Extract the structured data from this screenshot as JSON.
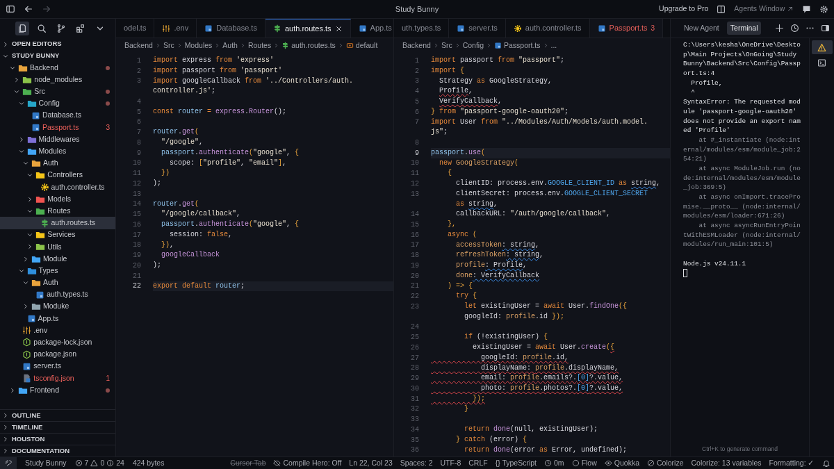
{
  "title_bar": {
    "title": "Study Bunny",
    "navigation": [
      {
        "kind": "back",
        "disabled": false
      },
      {
        "kind": "forward",
        "disabled": true
      }
    ],
    "actions": [
      {
        "kind": "upgrade",
        "label": "Upgrade to Pro"
      },
      {
        "kind": "agents",
        "label": "Agents Window"
      }
    ]
  },
  "activity": [
    {
      "kind": "explorer",
      "selected": true
    },
    {
      "kind": "search",
      "selected": false
    },
    {
      "kind": "scm",
      "selected": false
    },
    {
      "kind": "extensions",
      "selected": false
    },
    {
      "kind": "more",
      "selected": false
    }
  ],
  "explorer": {
    "sections": [
      {
        "title": "OPEN EDITORS",
        "expanded": false
      },
      {
        "title": "STUDY BUNNY",
        "expanded": true
      }
    ],
    "tree": [
      {
        "name": "Backend",
        "kind": "folder",
        "color": "#e8a33d",
        "expanded": true,
        "modified": true,
        "selected": false,
        "children": [
          {
            "name": "node_modules",
            "kind": "folder",
            "color": "#8bc34a",
            "expanded": false,
            "selected": false
          },
          {
            "name": "Src",
            "kind": "folder",
            "color": "#4caf50",
            "expanded": true,
            "modified": true,
            "selected": false,
            "children": [
              {
                "name": "Config",
                "kind": "folder",
                "color": "#26a6c9",
                "expanded": true,
                "modified": true,
                "selected": false,
                "children": [
                  {
                    "name": "Database.ts",
                    "kind": "ts",
                    "selected": false
                  },
                  {
                    "name": "Passport.ts",
                    "kind": "ts",
                    "error": true,
                    "badge": "3",
                    "selected": false
                  }
                ]
              },
              {
                "name": "Middlewares",
                "kind": "folder",
                "color": "#7e6fd6",
                "expanded": false,
                "selected": false
              },
              {
                "name": "Modules",
                "kind": "folder",
                "color": "#42a5f5",
                "expanded": true,
                "selected": false,
                "children": [
                  {
                    "name": "Auth",
                    "kind": "folder",
                    "color": "#e8a33d",
                    "expanded": true,
                    "selected": false,
                    "children": [
                      {
                        "name": "Controllers",
                        "kind": "folder",
                        "color": "#f5c518",
                        "expanded": true,
                        "selected": false,
                        "children": [
                          {
                            "name": "auth.controller.ts",
                            "kind": "gear",
                            "selected": false
                          }
                        ]
                      },
                      {
                        "name": "Models",
                        "kind": "folder",
                        "color": "#ef5350",
                        "expanded": false,
                        "selected": false
                      },
                      {
                        "name": "Routes",
                        "kind": "folder",
                        "color": "#4caf50",
                        "expanded": true,
                        "selected": false,
                        "children": [
                          {
                            "name": "auth.routes.ts",
                            "kind": "route",
                            "selected": true
                          }
                        ]
                      },
                      {
                        "name": "Services",
                        "kind": "folder",
                        "color": "#f5c518",
                        "expanded": true,
                        "selected": false
                      },
                      {
                        "name": "Utils",
                        "kind": "folder",
                        "color": "#8bc34a",
                        "expanded": false,
                        "selected": false
                      }
                    ]
                  },
                  {
                    "name": "Module",
                    "kind": "folder",
                    "color": "#42a5f5",
                    "expanded": false,
                    "selected": false
                  }
                ]
              },
              {
                "name": "Types",
                "kind": "folder",
                "color": "#2f8fdc",
                "expanded": true,
                "selected": false,
                "children": [
                  {
                    "name": "Auth",
                    "kind": "folder",
                    "color": "#e8a33d",
                    "expanded": true,
                    "selected": false,
                    "children": [
                      {
                        "name": "auth.types.ts",
                        "kind": "ts",
                        "selected": false
                      }
                    ]
                  },
                  {
                    "name": "Moduke",
                    "kind": "folder",
                    "color": "#90a4ae",
                    "expanded": false,
                    "selected": false
                  }
                ]
              },
              {
                "name": "App.ts",
                "kind": "ts",
                "selected": false
              }
            ]
          },
          {
            "name": ".env",
            "kind": "env",
            "selected": false
          },
          {
            "name": "package-lock.json",
            "kind": "json",
            "selected": false
          },
          {
            "name": "package.json",
            "kind": "json",
            "selected": false
          },
          {
            "name": "server.ts",
            "kind": "ts",
            "selected": false
          },
          {
            "name": "tsconfig.json",
            "kind": "tsconfig",
            "error": true,
            "badge": "1",
            "selected": false
          }
        ]
      },
      {
        "name": "Frontend",
        "kind": "folder",
        "color": "#42a5f5",
        "expanded": false,
        "modified": true,
        "selected": false
      }
    ],
    "panels": [
      {
        "title": "OUTLINE",
        "expanded": false
      },
      {
        "title": "TIMELINE",
        "expanded": false
      },
      {
        "title": "HOUSTON",
        "expanded": false
      },
      {
        "title": "DOCUMENTATION",
        "expanded": false
      }
    ]
  },
  "editors": [
    {
      "focused": true,
      "tabs": [
        {
          "label": "odel.ts",
          "selected": false
        },
        {
          "label": ".env",
          "kind": "env",
          "selected": false
        },
        {
          "label": "Database.ts",
          "kind": "ts",
          "selected": false
        },
        {
          "label": "auth.routes.ts",
          "kind": "route",
          "selected": true
        },
        {
          "label": "App.ts",
          "kind": "ts",
          "selected": false
        }
      ],
      "breadcrumbs": [
        {
          "label": "Backend",
          "kind": "folder"
        },
        {
          "label": "Src",
          "kind": "folder"
        },
        {
          "label": "Modules",
          "kind": "folder"
        },
        {
          "label": "Auth",
          "kind": "folder"
        },
        {
          "label": "Routes",
          "kind": "folder"
        },
        {
          "label": "auth.routes.ts",
          "kind": "route"
        },
        {
          "label": "default",
          "kind": "symbol"
        }
      ],
      "lines": [
        {
          "n": "1",
          "seg": [
            {
              "text": "import ",
              "kind": "keyword"
            },
            {
              "text": "express ",
              "kind": "plain"
            },
            {
              "text": "from ",
              "kind": "keyword"
            },
            {
              "text": "'express'",
              "kind": "string"
            }
          ]
        },
        {
          "n": "2",
          "seg": [
            {
              "text": "import ",
              "kind": "keyword"
            },
            {
              "text": "passport ",
              "kind": "plain"
            },
            {
              "text": "from ",
              "kind": "keyword"
            },
            {
              "text": "'passport'",
              "kind": "string"
            }
          ]
        },
        {
          "n": "3",
          "seg": [
            {
              "text": "import ",
              "kind": "keyword"
            },
            {
              "text": "googleCallback ",
              "kind": "plain"
            },
            {
              "text": "from ",
              "kind": "keyword"
            },
            {
              "text": "'../Controllers/auth.",
              "kind": "string"
            }
          ]
        },
        {
          "seg": [
            {
              "text": "controller.js'",
              "kind": "string"
            },
            {
              "text": ";",
              "kind": "plain"
            }
          ]
        },
        {
          "n": "4"
        },
        {
          "n": "5",
          "seg": [
            {
              "text": "const ",
              "kind": "keyword"
            },
            {
              "text": "router ",
              "kind": "variable"
            },
            {
              "text": "= ",
              "kind": "keyword"
            },
            {
              "text": "express",
              "kind": "function"
            },
            {
              "text": ".",
              "kind": "plain"
            },
            {
              "text": "Router",
              "kind": "function"
            },
            {
              "text": "();",
              "kind": "plain"
            }
          ]
        },
        {
          "n": "6"
        },
        {
          "n": "7",
          "seg": [
            {
              "text": "router",
              "kind": "variable"
            },
            {
              "text": ".",
              "kind": "plain"
            },
            {
              "text": "get",
              "kind": "function"
            },
            {
              "text": "(",
              "kind": "bracket"
            }
          ]
        },
        {
          "n": "8",
          "seg": [
            {
              "text": "  \"/google\"",
              "kind": "string"
            },
            {
              "text": ",",
              "kind": "plain"
            }
          ]
        },
        {
          "n": "9",
          "seg": [
            {
              "text": "  passport",
              "kind": "variable"
            },
            {
              "text": ".",
              "kind": "plain"
            },
            {
              "text": "authenticate",
              "kind": "function"
            },
            {
              "text": "(",
              "kind": "bracket"
            },
            {
              "text": "\"google\"",
              "kind": "string"
            },
            {
              "text": ", ",
              "kind": "plain"
            },
            {
              "text": "{",
              "kind": "bracket"
            }
          ]
        },
        {
          "n": "10",
          "seg": [
            {
              "text": "    scope: ",
              "kind": "plain"
            },
            {
              "text": "[",
              "kind": "bracket"
            },
            {
              "text": "\"profile\"",
              "kind": "string"
            },
            {
              "text": ", ",
              "kind": "plain"
            },
            {
              "text": "\"email\"",
              "kind": "string"
            },
            {
              "text": "]",
              "kind": "bracket"
            },
            {
              "text": ",",
              "kind": "plain"
            }
          ]
        },
        {
          "n": "11",
          "seg": [
            {
              "text": "  })",
              "kind": "bracket"
            }
          ]
        },
        {
          "n": "12",
          "seg": [
            {
              "text": ");",
              "kind": "plain"
            }
          ]
        },
        {
          "n": "13"
        },
        {
          "n": "14",
          "seg": [
            {
              "text": "router",
              "kind": "variable"
            },
            {
              "text": ".",
              "kind": "plain"
            },
            {
              "text": "get",
              "kind": "function"
            },
            {
              "text": "(",
              "kind": "bracket"
            }
          ]
        },
        {
          "n": "15",
          "seg": [
            {
              "text": "  \"/google/callback\"",
              "kind": "string"
            },
            {
              "text": ",",
              "kind": "plain"
            }
          ]
        },
        {
          "n": "16",
          "seg": [
            {
              "text": "  passport",
              "kind": "variable"
            },
            {
              "text": ".",
              "kind": "plain"
            },
            {
              "text": "authenticate",
              "kind": "function"
            },
            {
              "text": "(",
              "kind": "bracket"
            },
            {
              "text": "\"google\"",
              "kind": "string"
            },
            {
              "text": ", ",
              "kind": "plain"
            },
            {
              "text": "{",
              "kind": "bracket"
            }
          ]
        },
        {
          "n": "17",
          "seg": [
            {
              "text": "    session: ",
              "kind": "plain"
            },
            {
              "text": "false",
              "kind": "keyword"
            },
            {
              "text": ",",
              "kind": "plain"
            }
          ]
        },
        {
          "n": "18",
          "seg": [
            {
              "text": "  })",
              "kind": "bracket"
            },
            {
              "text": ",",
              "kind": "plain"
            }
          ]
        },
        {
          "n": "19",
          "seg": [
            {
              "text": "  googleCallback",
              "kind": "function"
            }
          ]
        },
        {
          "n": "20",
          "seg": [
            {
              "text": ");",
              "kind": "plain"
            }
          ]
        },
        {
          "n": "21"
        },
        {
          "n": "22",
          "current": true,
          "seg": [
            {
              "text": "export default ",
              "kind": "keyword"
            },
            {
              "text": "router",
              "kind": "variable"
            },
            {
              "text": ";",
              "kind": "plain"
            }
          ]
        }
      ]
    },
    {
      "focused": false,
      "tabs": [
        {
          "label": "uth.types.ts",
          "selected": false
        },
        {
          "label": "server.ts",
          "kind": "ts",
          "selected": false
        },
        {
          "label": "auth.controller.ts",
          "kind": "gear",
          "selected": false
        },
        {
          "label": "Passport.ts",
          "kind": "ts",
          "selected": true,
          "error": true,
          "badge": "3"
        }
      ],
      "breadcrumbs": [
        {
          "label": "Backend",
          "kind": "folder"
        },
        {
          "label": "Src",
          "kind": "folder"
        },
        {
          "label": "Config",
          "kind": "folder"
        },
        {
          "label": "Passport.ts",
          "kind": "ts"
        },
        {
          "label": "...",
          "kind": "more"
        }
      ],
      "lines": [
        {
          "n": "1",
          "seg": [
            {
              "text": "import ",
              "kind": "keyword"
            },
            {
              "text": "passport ",
              "kind": "plain"
            },
            {
              "text": "from ",
              "kind": "keyword"
            },
            {
              "text": "\"passport\"",
              "kind": "string"
            },
            {
              "text": ";",
              "kind": "plain"
            }
          ]
        },
        {
          "n": "2",
          "seg": [
            {
              "text": "import ",
              "kind": "keyword"
            },
            {
              "text": "{",
              "kind": "bracket"
            }
          ]
        },
        {
          "n": "3",
          "seg": [
            {
              "text": "  Strategy ",
              "kind": "plain"
            },
            {
              "text": "as ",
              "kind": "keyword"
            },
            {
              "text": "GoogleStrategy,",
              "kind": "plain"
            }
          ]
        },
        {
          "n": "4",
          "seg": [
            {
              "text": "  Profile",
              "kind": "plain",
              "error": true
            },
            {
              "text": ",",
              "kind": "plain"
            }
          ]
        },
        {
          "n": "5",
          "seg": [
            {
              "text": "  VerifyCallback",
              "kind": "plain",
              "error": true
            },
            {
              "text": ",",
              "kind": "plain"
            }
          ]
        },
        {
          "n": "6",
          "seg": [
            {
              "text": "} ",
              "kind": "bracket"
            },
            {
              "text": "from ",
              "kind": "keyword"
            },
            {
              "text": "\"passport-google-oauth20\"",
              "kind": "string"
            },
            {
              "text": ";",
              "kind": "plain"
            }
          ]
        },
        {
          "n": "7",
          "seg": [
            {
              "text": "import ",
              "kind": "keyword"
            },
            {
              "text": "User ",
              "kind": "plain"
            },
            {
              "text": "from ",
              "kind": "keyword"
            },
            {
              "text": "\"../Modules/Auth/Models/auth.model.",
              "kind": "string"
            }
          ]
        },
        {
          "seg": [
            {
              "text": "js\"",
              "kind": "string"
            },
            {
              "text": ";",
              "kind": "plain"
            }
          ]
        },
        {
          "n": "8"
        },
        {
          "n": "9",
          "current": true,
          "seg": [
            {
              "text": "passport",
              "kind": "variable"
            },
            {
              "text": ".",
              "kind": "plain"
            },
            {
              "text": "use",
              "kind": "function"
            },
            {
              "text": "(",
              "kind": "bracket"
            }
          ]
        },
        {
          "n": "10",
          "seg": [
            {
              "text": "  new ",
              "kind": "keyword"
            },
            {
              "text": "GoogleStrategy",
              "kind": "param"
            },
            {
              "text": "(",
              "kind": "bracket"
            }
          ]
        },
        {
          "n": "11",
          "seg": [
            {
              "text": "    {",
              "kind": "bracket"
            }
          ]
        },
        {
          "n": "12",
          "seg": [
            {
              "text": "      clientID: process.env.",
              "kind": "plain"
            },
            {
              "text": "GOOGLE_CLIENT_ID ",
              "kind": "constant"
            },
            {
              "text": "as ",
              "kind": "keyword"
            },
            {
              "text": "string",
              "kind": "plain",
              "warning": true
            },
            {
              "text": ",",
              "kind": "plain"
            }
          ]
        },
        {
          "n": "13",
          "seg": [
            {
              "text": "      clientSecret: process.env.",
              "kind": "plain"
            },
            {
              "text": "GOOGLE_CLIENT_SECRET",
              "kind": "constant"
            }
          ]
        },
        {
          "seg": [
            {
              "text": "      as ",
              "kind": "keyword"
            },
            {
              "text": "string",
              "kind": "plain",
              "warning": true
            },
            {
              "text": ",",
              "kind": "plain"
            }
          ]
        },
        {
          "n": "14",
          "seg": [
            {
              "text": "      callbackURL: ",
              "kind": "plain"
            },
            {
              "text": "\"/auth/google/callback\"",
              "kind": "string"
            },
            {
              "text": ",",
              "kind": "plain"
            }
          ]
        },
        {
          "n": "15",
          "seg": [
            {
              "text": "    },",
              "kind": "bracket"
            }
          ]
        },
        {
          "n": "16",
          "seg": [
            {
              "text": "    async ",
              "kind": "keyword"
            },
            {
              "text": "(",
              "kind": "bracket"
            }
          ]
        },
        {
          "n": "17",
          "seg": [
            {
              "text": "      accessToken",
              "kind": "param"
            },
            {
              "text": ": string",
              "kind": "plain",
              "warning": true
            },
            {
              "text": ",",
              "kind": "plain"
            }
          ]
        },
        {
          "n": "18",
          "seg": [
            {
              "text": "      refreshToken",
              "kind": "param"
            },
            {
              "text": ": string",
              "kind": "plain",
              "warning": true
            },
            {
              "text": ",",
              "kind": "plain"
            }
          ]
        },
        {
          "n": "19",
          "seg": [
            {
              "text": "      profile",
              "kind": "param"
            },
            {
              "text": ": Profile",
              "kind": "plain",
              "warning": true
            },
            {
              "text": ",",
              "kind": "plain"
            }
          ]
        },
        {
          "n": "20",
          "seg": [
            {
              "text": "      done",
              "kind": "param"
            },
            {
              "text": ": VerifyCallback",
              "kind": "plain",
              "warning": true
            }
          ]
        },
        {
          "n": "21",
          "seg": [
            {
              "text": "    ) => {",
              "kind": "bracket"
            }
          ]
        },
        {
          "n": "22",
          "seg": [
            {
              "text": "      try ",
              "kind": "keyword"
            },
            {
              "text": "{",
              "kind": "bracket"
            }
          ]
        },
        {
          "n": "23",
          "seg": [
            {
              "text": "        let ",
              "kind": "keyword"
            },
            {
              "text": "existingUser = ",
              "kind": "plain"
            },
            {
              "text": "await ",
              "kind": "keyword"
            },
            {
              "text": "User.",
              "kind": "plain"
            },
            {
              "text": "findOne",
              "kind": "function"
            },
            {
              "text": "({",
              "kind": "bracket"
            }
          ]
        },
        {
          "seg": [
            {
              "text": "        googleId: ",
              "kind": "plain"
            },
            {
              "text": "profile",
              "kind": "param"
            },
            {
              "text": ".id ",
              "kind": "plain"
            },
            {
              "text": "});",
              "kind": "bracket"
            }
          ]
        },
        {
          "n": "24"
        },
        {
          "n": "25",
          "seg": [
            {
              "text": "        if ",
              "kind": "keyword"
            },
            {
              "text": "(!existingUser) ",
              "kind": "plain"
            },
            {
              "text": "{",
              "kind": "bracket"
            }
          ]
        },
        {
          "n": "26",
          "seg": [
            {
              "text": "          existingUser = ",
              "kind": "plain"
            },
            {
              "text": "await ",
              "kind": "keyword"
            },
            {
              "text": "User.",
              "kind": "plain"
            },
            {
              "text": "create",
              "kind": "function"
            },
            {
              "text": "(",
              "kind": "bracket"
            },
            {
              "text": "{",
              "kind": "bracket",
              "error": true
            }
          ]
        },
        {
          "n": "27",
          "error": true,
          "seg": [
            {
              "text": "            googleId: ",
              "kind": "plain"
            },
            {
              "text": "profile",
              "kind": "param"
            },
            {
              "text": ".id,",
              "kind": "plain"
            }
          ]
        },
        {
          "n": "28",
          "error": true,
          "seg": [
            {
              "text": "            displayName: ",
              "kind": "plain"
            },
            {
              "text": "profile",
              "kind": "param"
            },
            {
              "text": ".displayName,",
              "kind": "plain"
            }
          ]
        },
        {
          "n": "29",
          "error": true,
          "seg": [
            {
              "text": "            email: ",
              "kind": "plain"
            },
            {
              "text": "profile",
              "kind": "param"
            },
            {
              "text": ".emails?.",
              "kind": "plain"
            },
            {
              "text": "[0]",
              "kind": "constant"
            },
            {
              "text": "?.value,",
              "kind": "plain"
            }
          ]
        },
        {
          "n": "30",
          "error": true,
          "seg": [
            {
              "text": "            photo: ",
              "kind": "plain"
            },
            {
              "text": "profile",
              "kind": "param"
            },
            {
              "text": ".photos?.",
              "kind": "plain"
            },
            {
              "text": "[0]",
              "kind": "constant"
            },
            {
              "text": "?.value,",
              "kind": "plain"
            }
          ]
        },
        {
          "n": "31",
          "error": true,
          "seg": [
            {
              "text": "          });",
              "kind": "bracket"
            }
          ]
        },
        {
          "n": "32",
          "seg": [
            {
              "text": "        }",
              "kind": "bracket"
            }
          ]
        },
        {
          "n": "33"
        },
        {
          "n": "34",
          "seg": [
            {
              "text": "        return ",
              "kind": "keyword"
            },
            {
              "text": "done",
              "kind": "function"
            },
            {
              "text": "(null, existingUser);",
              "kind": "plain"
            }
          ]
        },
        {
          "n": "35",
          "seg": [
            {
              "text": "      } ",
              "kind": "bracket"
            },
            {
              "text": "catch ",
              "kind": "keyword"
            },
            {
              "text": "(error) ",
              "kind": "plain"
            },
            {
              "text": "{",
              "kind": "bracket"
            }
          ]
        },
        {
          "n": "36",
          "seg": [
            {
              "text": "        return ",
              "kind": "keyword"
            },
            {
              "text": "done",
              "kind": "function"
            },
            {
              "text": "(error ",
              "kind": "plain"
            },
            {
              "text": "as ",
              "kind": "keyword"
            },
            {
              "text": "Error, undefined);",
              "kind": "plain"
            }
          ]
        }
      ]
    }
  ],
  "panel": {
    "tabs": [
      {
        "label": "New Agent",
        "selected": false
      },
      {
        "label": "Terminal",
        "selected": true
      }
    ],
    "side": [
      {
        "kind": "warning",
        "selected": true
      },
      {
        "kind": "terminal",
        "selected": false
      }
    ],
    "lines": [
      {
        "kind": "out",
        "text": "C:\\Users\\kesha\\OneDrive\\Deskto"
      },
      {
        "kind": "out",
        "text": "p\\Main Projects\\OnGoing\\Study"
      },
      {
        "kind": "out",
        "text": "Bunny\\Backend\\Src\\Config\\Passp"
      },
      {
        "kind": "out",
        "text": "ort.ts:4"
      },
      {
        "kind": "out",
        "text": "  Profile,"
      },
      {
        "kind": "out",
        "text": "  ^"
      },
      {
        "kind": "out",
        "text": "SyntaxError: The requested mod"
      },
      {
        "kind": "out",
        "text": "ule 'passport-google-oauth20'"
      },
      {
        "kind": "out",
        "text": "does not provide an export nam"
      },
      {
        "kind": "out",
        "text": "ed 'Profile'"
      },
      {
        "kind": "dim",
        "text": "    at #_instantiate (node:int"
      },
      {
        "kind": "dim",
        "text": "ernal/modules/esm/module_job:2"
      },
      {
        "kind": "dim",
        "text": "54:21)"
      },
      {
        "kind": "dim",
        "text": "    at async ModuleJob.run (no"
      },
      {
        "kind": "dim",
        "text": "de:internal/modules/esm/module"
      },
      {
        "kind": "dim",
        "text": "_job:369:5)"
      },
      {
        "kind": "dim",
        "text": "    at async onImport.tracePro"
      },
      {
        "kind": "dim",
        "text": "mise.__proto__ (node:internal/"
      },
      {
        "kind": "dim",
        "text": "modules/esm/loader:671:26)"
      },
      {
        "kind": "dim",
        "text": "    at async asyncRunEntryPoin"
      },
      {
        "kind": "dim",
        "text": "tWithESMLoader (node:internal/"
      },
      {
        "kind": "dim",
        "text": "modules/run_main:101:5)"
      },
      {
        "kind": "gap"
      },
      {
        "kind": "out",
        "text": "Node.js v24.11.1"
      },
      {
        "kind": "cursor"
      }
    ],
    "hint": "Ctrl+K to generate command"
  },
  "status_bar": {
    "left": [
      {
        "kind": "remote"
      },
      {
        "kind": "text",
        "text": "Study Bunny"
      },
      {
        "kind": "problems",
        "errors": "7",
        "warnings": "0",
        "infos": "24"
      },
      {
        "kind": "text",
        "text": "424 bytes"
      }
    ],
    "right": [
      {
        "kind": "strike",
        "text": "Cursor Tab"
      },
      {
        "kind": "compile",
        "text": "Compile Hero: Off"
      },
      {
        "kind": "text",
        "text": "Ln 22, Col 23"
      },
      {
        "kind": "text",
        "text": "Spaces: 2"
      },
      {
        "kind": "text",
        "text": "UTF-8"
      },
      {
        "kind": "text",
        "text": "CRLF"
      },
      {
        "kind": "text",
        "text": "{} TypeScript"
      },
      {
        "kind": "timer",
        "text": "0m"
      },
      {
        "kind": "flow",
        "text": "Flow"
      },
      {
        "kind": "quokka",
        "text": "Quokka"
      },
      {
        "kind": "colorize",
        "text": "Colorize"
      },
      {
        "kind": "text",
        "text": "Colorize: 13 variables"
      },
      {
        "kind": "text",
        "text": "Formatting: ✓"
      },
      {
        "kind": "bell"
      }
    ]
  }
}
